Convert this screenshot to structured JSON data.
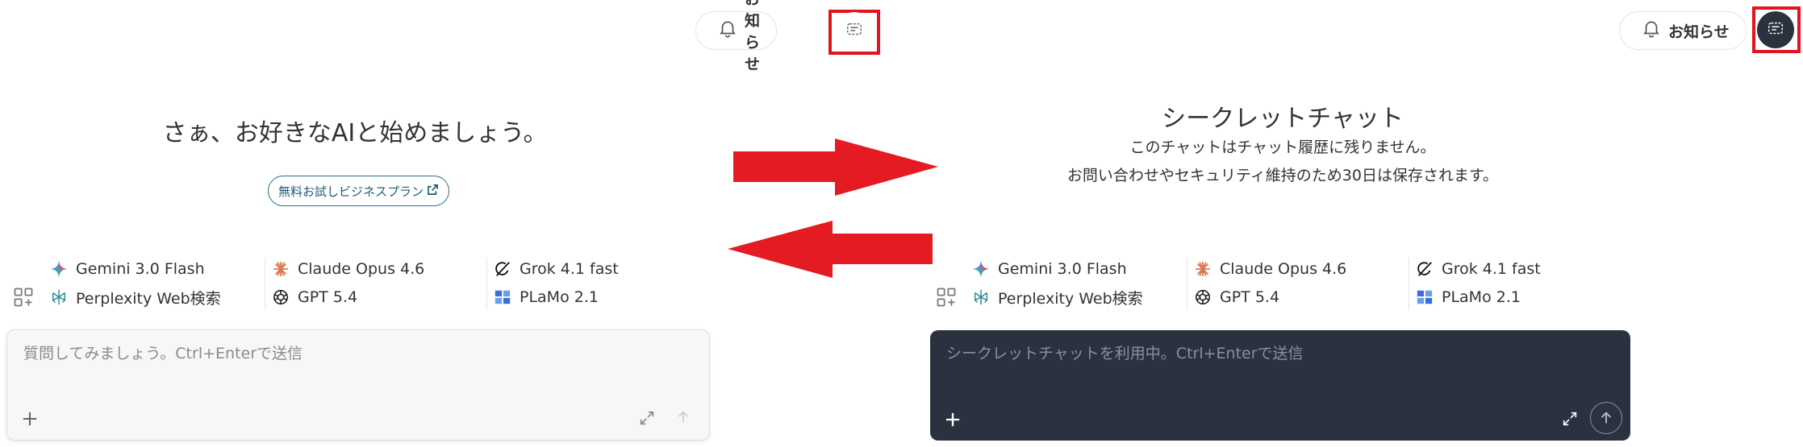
{
  "notice_label": "お知らせ",
  "left": {
    "headline": "さぁ、お好きなAIと始めましょう。",
    "trial_button": "無料お試しビジネスプラン",
    "input_placeholder": "質問してみましょう。Ctrl+Enterで送信"
  },
  "right": {
    "headline": "シークレットチャット",
    "description_line1": "このチャットはチャット履歴に残りません。",
    "description_line2": "お問い合わせやセキュリティ維持のため30日は保存されます。",
    "input_placeholder": "シークレットチャットを利用中。Ctrl+Enterで送信"
  },
  "models": [
    {
      "label": "Gemini 3.0 Flash",
      "icon": "gemini-icon"
    },
    {
      "label": "Claude Opus 4.6",
      "icon": "claude-icon"
    },
    {
      "label": "Grok 4.1 fast",
      "icon": "grok-icon"
    },
    {
      "label": "Perplexity Web検索",
      "icon": "perplexity-icon"
    },
    {
      "label": "GPT 5.4",
      "icon": "openai-icon"
    },
    {
      "label": "PLaMo 2.1",
      "icon": "plamo-icon"
    }
  ],
  "colors": {
    "highlight_red": "#e0151f",
    "secret_dark": "#2c3140",
    "trial_border": "#2b6f8a"
  }
}
